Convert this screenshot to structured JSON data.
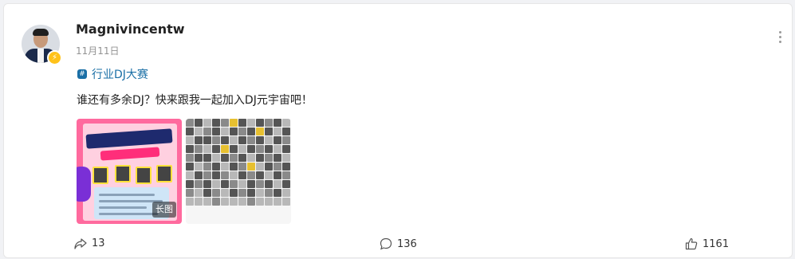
{
  "post": {
    "author": "Magnivincentw",
    "date": "11月11日",
    "topic": "行业DJ大赛",
    "text": "谁还有多余DJ？快来跟我一起加入DJ元宇宙吧！",
    "images": [
      {
        "badge": "长图",
        "alt": "poster"
      },
      {
        "alt": "grid"
      }
    ],
    "icons": {
      "verified": "verified-badge-icon",
      "more": "more-vertical-icon",
      "topic": "topic-icon",
      "share": "share-icon",
      "comment": "comment-icon",
      "like": "thumbs-up-icon"
    }
  },
  "actions": {
    "share_count": "13",
    "comment_count": "136",
    "like_count": "1161"
  },
  "colors": {
    "topic_link": "#1a6fa6",
    "badge_yellow": "#ffc21a"
  }
}
